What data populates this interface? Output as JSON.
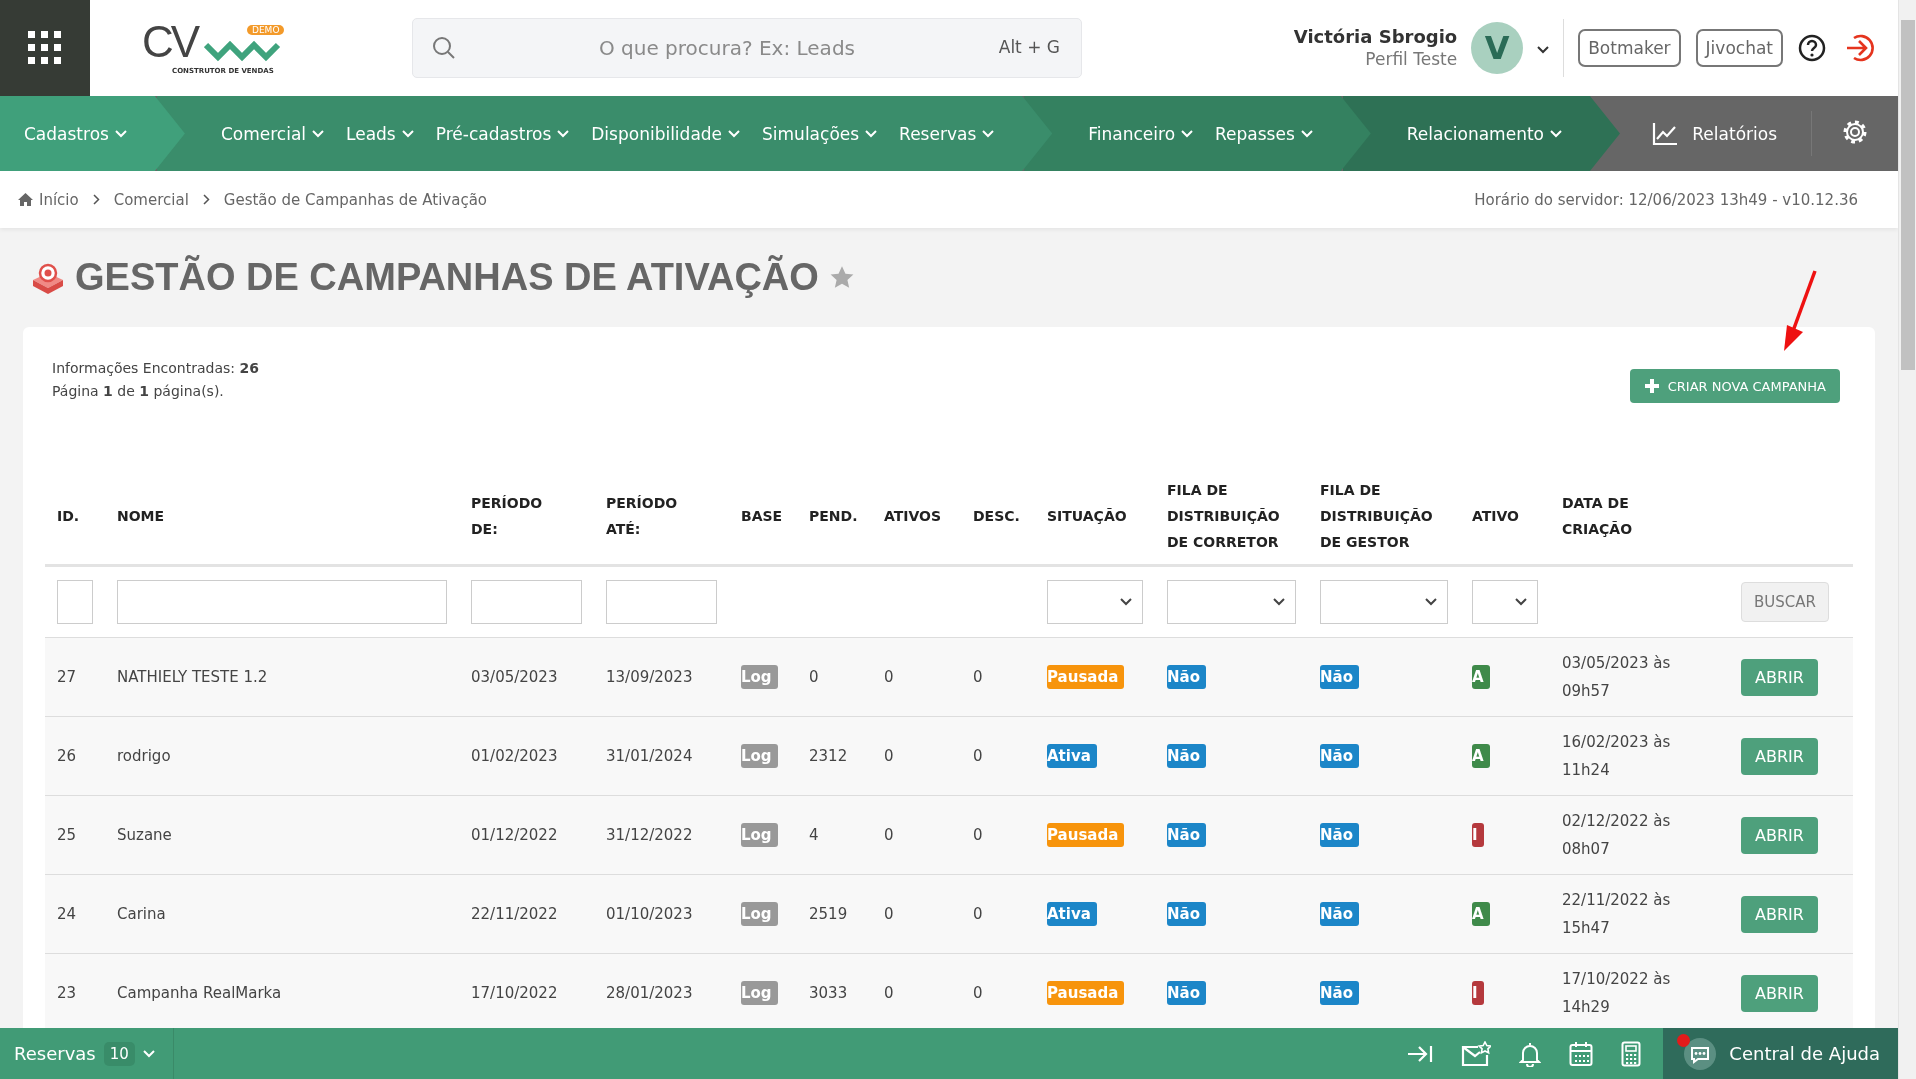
{
  "header": {
    "logo": {
      "text": "CV",
      "badge": "DEMO",
      "tagline": "CONSTRUTOR DE VENDAS"
    },
    "search": {
      "placeholder": "O que procura? Ex: Leads",
      "shortcut": "Alt + G"
    },
    "user": {
      "name": "Victória Sbrogio",
      "profile": "Perfil Teste",
      "initial": "V"
    },
    "buttons": [
      "Botmaker",
      "Jivochat"
    ]
  },
  "nav": {
    "groups": [
      {
        "items": [
          "Cadastros"
        ]
      },
      {
        "items": [
          "Comercial",
          "Leads",
          "Pré-cadastros",
          "Disponibilidade",
          "Simulações",
          "Reservas"
        ]
      },
      {
        "items": [
          "Financeiro",
          "Repasses"
        ]
      },
      {
        "items": [
          "Relacionamento"
        ]
      }
    ],
    "reports": "Relatórios"
  },
  "breadcrumb": [
    "Início",
    "Comercial",
    "Gestão de Campanhas de Ativação"
  ],
  "server_time": "Horário do servidor: 12/06/2023 13h49 - v10.12.36",
  "page_title": "GESTÃO DE CAMPANHAS DE ATIVAÇÃO",
  "info": {
    "found": "Informações Encontradas: **26**",
    "page": "Página **1** de **1** página(s)."
  },
  "create_button": "CRIAR NOVA CAMPANHA",
  "table": {
    "columns": [
      {
        "label": "ID.",
        "kind": "input"
      },
      {
        "label": "NOME",
        "kind": "input"
      },
      {
        "label": "PERÍODO DE:",
        "kind": "input"
      },
      {
        "label": "PERÍODO ATÉ:",
        "kind": "input"
      },
      {
        "label": "BASE",
        "kind": "plain"
      },
      {
        "label": "PEND.",
        "kind": "plain"
      },
      {
        "label": "ATIVOS",
        "kind": "plain"
      },
      {
        "label": "DESC.",
        "kind": "plain"
      },
      {
        "label": "SITUAÇÃO",
        "kind": "select"
      },
      {
        "label": "FILA DE DISTRIBUIÇÃO DE CORRETOR",
        "kind": "select"
      },
      {
        "label": "FILA DE DISTRIBUIÇÃO DE GESTOR",
        "kind": "select"
      },
      {
        "label": "ATIVO",
        "kind": "select"
      },
      {
        "label": "DATA DE CRIAÇÃO",
        "kind": "plain"
      }
    ],
    "search_button": "BUSCAR",
    "rows": [
      {
        "id": "27",
        "name": "NATHIELY TESTE 1.2",
        "from": "03/05/2023",
        "to": "13/09/2023",
        "base": "Log",
        "pend": "0",
        "ativos": "0",
        "desc": "0",
        "status": {
          "text": "Pausada",
          "kind": "paused"
        },
        "queue_broker": "Não",
        "queue_manager": "Não",
        "active": {
          "text": "A",
          "kind": "active"
        },
        "created": "03/05/2023 às 09h57",
        "action": "ABRIR"
      },
      {
        "id": "26",
        "name": "rodrigo",
        "from": "01/02/2023",
        "to": "31/01/2024",
        "base": "Log",
        "pend": "2312",
        "ativos": "0",
        "desc": "0",
        "status": {
          "text": "Ativa",
          "kind": "running"
        },
        "queue_broker": "Não",
        "queue_manager": "Não",
        "active": {
          "text": "A",
          "kind": "active"
        },
        "created": "16/02/2023 às 11h24",
        "action": "ABRIR"
      },
      {
        "id": "25",
        "name": "Suzane",
        "from": "01/12/2022",
        "to": "31/12/2022",
        "base": "Log",
        "pend": "4",
        "ativos": "0",
        "desc": "0",
        "status": {
          "text": "Pausada",
          "kind": "paused"
        },
        "queue_broker": "Não",
        "queue_manager": "Não",
        "active": {
          "text": "I",
          "kind": "inactive"
        },
        "created": "02/12/2022 às 08h07",
        "action": "ABRIR"
      },
      {
        "id": "24",
        "name": "Carina",
        "from": "22/11/2022",
        "to": "01/10/2023",
        "base": "Log",
        "pend": "2519",
        "ativos": "0",
        "desc": "0",
        "status": {
          "text": "Ativa",
          "kind": "running"
        },
        "queue_broker": "Não",
        "queue_manager": "Não",
        "active": {
          "text": "A",
          "kind": "active"
        },
        "created": "22/11/2022 às 15h47",
        "action": "ABRIR"
      },
      {
        "id": "23",
        "name": "Campanha RealMarka",
        "from": "17/10/2022",
        "to": "28/01/2023",
        "base": "Log",
        "pend": "3033",
        "ativos": "0",
        "desc": "0",
        "status": {
          "text": "Pausada",
          "kind": "paused"
        },
        "queue_broker": "Não",
        "queue_manager": "Não",
        "active": {
          "text": "I",
          "kind": "inactive"
        },
        "created": "17/10/2022 às 14h29",
        "action": "ABRIR"
      }
    ]
  },
  "bottom_bar": {
    "reservas": "Reservas",
    "count": "10",
    "help": "Central de Ajuda"
  }
}
